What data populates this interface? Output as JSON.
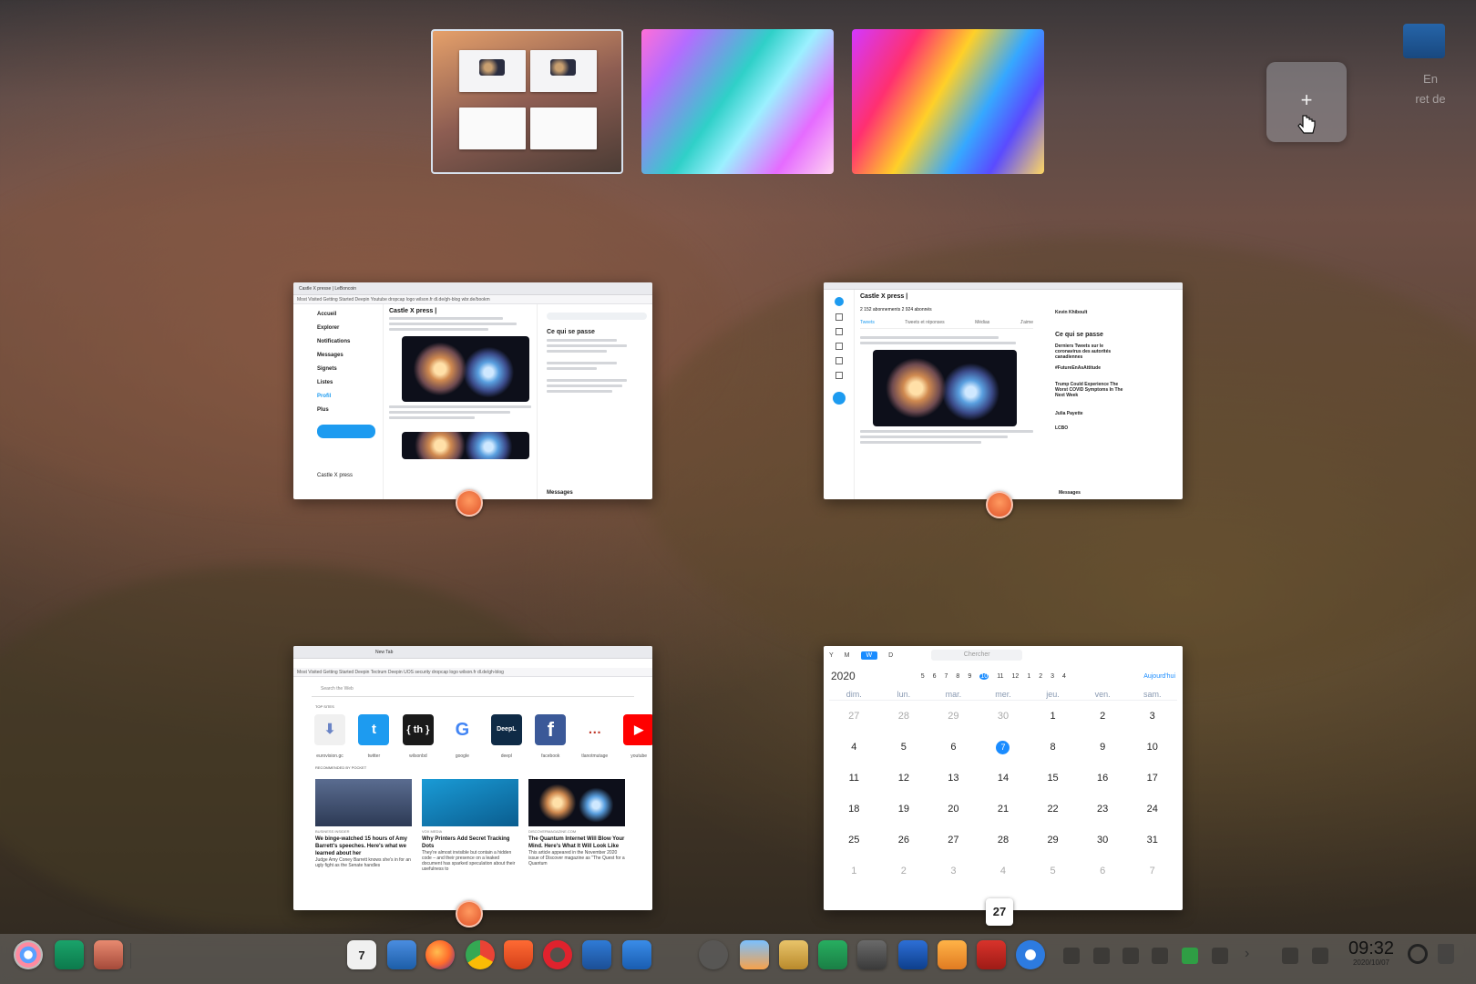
{
  "workspace_switcher": {
    "workspaces": [
      "workspace-1",
      "workspace-2",
      "workspace-3"
    ],
    "add_label": "+"
  },
  "desktop": {
    "icon_label_line1": "En",
    "icon_label_line2": "ret de"
  },
  "windows": {
    "twitter1": {
      "tabs": "Castle X presse | LeBoncoin",
      "bookmarks": "Most Visited  Getting Started  Deepin Youtube  dropcap logo  wilson.fr  dl.de/gh-blog  wbr.de/bookm",
      "profile": "Castle X press |",
      "nav": [
        "Accueil",
        "Explorer",
        "Notifications",
        "Messages",
        "Signets",
        "Listes",
        "Profil",
        "Plus"
      ],
      "right_title": "Ce qui se passe",
      "messages": "Messages",
      "account": "Castle X press"
    },
    "twitter2": {
      "profile": "Castle X press |",
      "stats": "2 152  abonnements   2 924  abonnés",
      "tabs": [
        "Tweets",
        "Tweets et réponses",
        "Médias",
        "J'aime"
      ],
      "right_title": "Ce qui se passe",
      "messages": "Messages",
      "user": "Kevin Khiboult",
      "trend1": "Derniers Tweets sur le coronavirus des autorités canadiennes",
      "trend2": "#FutureEnAsAttitude",
      "trend3": "Trump Could Experience The Worst COVID Symptoms In The Next Week",
      "trend4": "Julia Payette",
      "trend5": "LCBO"
    },
    "newtab": {
      "tabs": "New Tab",
      "bookmarks": "Most Visited  Getting Started  Deepin Tectrum  Deepin UOS security  dropcap logo  wilson.fr  dl.de/gh-blog",
      "search_placeholder": "Search the Web",
      "top_sites_title": "TOP SITES",
      "top_sites": [
        {
          "label": "eurovision.gc",
          "glyph": "⬇"
        },
        {
          "label": "twitter",
          "glyph": "t"
        },
        {
          "label": "wilsonbd",
          "glyph": "{ th }"
        },
        {
          "label": "google",
          "glyph": "G"
        },
        {
          "label": "deepl",
          "glyph": "DeepL"
        },
        {
          "label": "facebook",
          "glyph": "f"
        },
        {
          "label": "tlanotmutage",
          "glyph": "…"
        },
        {
          "label": "youtube",
          "glyph": "▶"
        }
      ],
      "pocket_title": "RECOMMENDED BY POCKET",
      "stories": [
        {
          "source": "BUSINESS INSIDER",
          "title": "We binge-watched 15 hours of Amy Barrett's speeches. Here's what we learned about her",
          "snippet": "Judge Amy Coney Barrett knows she's in for an ugly fight as the Senate handles"
        },
        {
          "source": "VOX MEDIA",
          "title": "Why Printers Add Secret Tracking Dots",
          "snippet": "They're almost invisible but contain a hidden code – and their presence on a leaked document has sparked speculation about their usefulness to"
        },
        {
          "source": "DISCOVERMAGAZINE.COM",
          "title": "The Quantum Internet Will Blow Your Mind. Here's What It Will Look Like",
          "snippet": "This article appeared in the November 2020 issue of Discover magazine as \"The Quest for a Quantum"
        }
      ]
    },
    "calendar": {
      "view_tabs": [
        "Y",
        "M",
        "W",
        "D"
      ],
      "search_placeholder": "Chercher",
      "year": "2020",
      "week_numbers": [
        "5",
        "6",
        "7",
        "8",
        "9",
        "10",
        "11",
        "12",
        "1",
        "2",
        "3",
        "4"
      ],
      "today_label": "Aujourd'hui",
      "day_names": [
        "dim.",
        "lun.",
        "mar.",
        "mer.",
        "jeu.",
        "ven.",
        "sam."
      ],
      "days": [
        [
          "27",
          "28",
          "29",
          "30",
          "1",
          "2",
          "3"
        ],
        [
          "4",
          "5",
          "6",
          "7",
          "8",
          "9",
          "10"
        ],
        [
          "11",
          "12",
          "13",
          "14",
          "15",
          "16",
          "17"
        ],
        [
          "18",
          "19",
          "20",
          "21",
          "22",
          "23",
          "24"
        ],
        [
          "25",
          "26",
          "27",
          "28",
          "29",
          "30",
          "31"
        ],
        [
          "1",
          "2",
          "3",
          "4",
          "5",
          "6",
          "7"
        ]
      ],
      "today": "7",
      "badge": "27"
    }
  },
  "dock": {
    "clock_time": "09:32",
    "clock_date": "2020/10/07",
    "calendar_icon_day": "7"
  }
}
